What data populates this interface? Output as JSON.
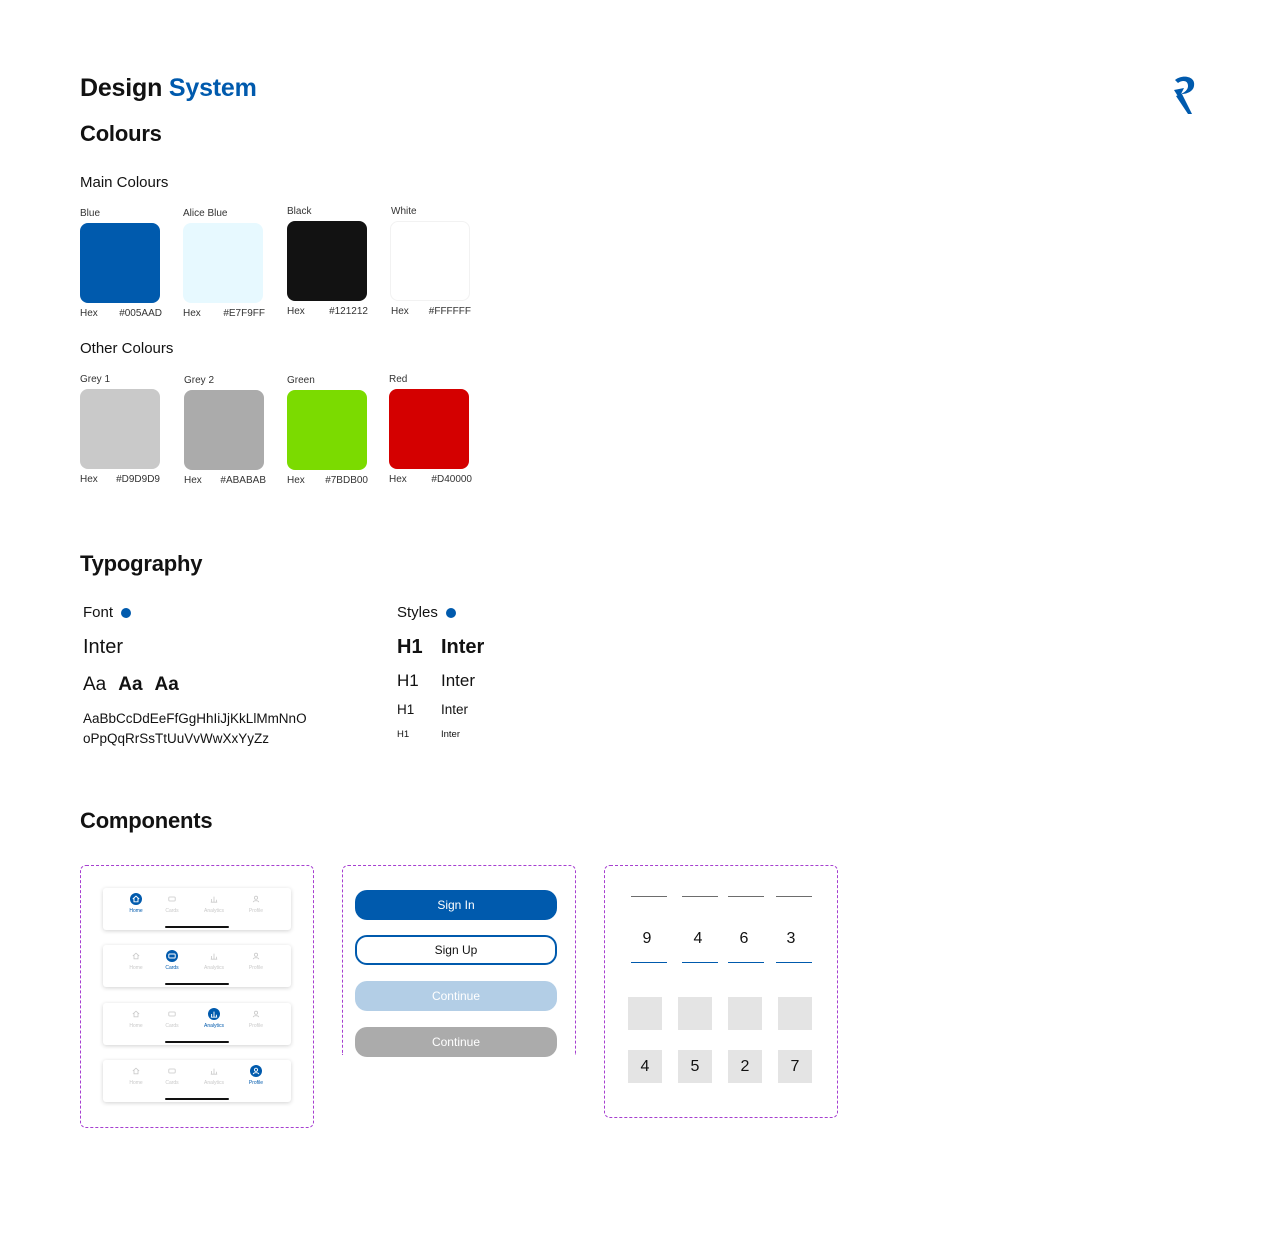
{
  "title": {
    "part1": "Design",
    "part2": "System"
  },
  "colours": {
    "heading": "Colours",
    "main": {
      "heading": "Main Colours",
      "swatches": [
        {
          "name": "Blue",
          "hex_label": "Hex",
          "hex": "#005AAD"
        },
        {
          "name": "Alice Blue",
          "hex_label": "Hex",
          "hex": "#E7F9FF"
        },
        {
          "name": "Black",
          "hex_label": "Hex",
          "hex": "#121212"
        },
        {
          "name": "White",
          "hex_label": "Hex",
          "hex": "#FFFFFF"
        }
      ]
    },
    "other": {
      "heading": "Other Colours",
      "swatches": [
        {
          "name": "Grey 1",
          "hex_label": "Hex",
          "hex": "#D9D9D9"
        },
        {
          "name": "Grey 2",
          "hex_label": "Hex",
          "hex": "#ABABAB"
        },
        {
          "name": "Green",
          "hex_label": "Hex",
          "hex": "#7BDB00"
        },
        {
          "name": "Red",
          "hex_label": "Hex",
          "hex": "#D40000"
        }
      ]
    }
  },
  "typography": {
    "heading": "Typography",
    "font": {
      "label": "Font",
      "name": "Inter",
      "samples": [
        "Aa",
        "Aa",
        "Aa"
      ],
      "alphabet_line1": "AaBbCcDdEeFfGgHhIiJjKkLlMmNnO",
      "alphabet_line2": "oPpQqRrSsTtUuVvWwXxYyZz"
    },
    "styles": {
      "label": "Styles",
      "rows": [
        {
          "tag": "H1",
          "font": "Inter"
        },
        {
          "tag": "H1",
          "font": "Inter"
        },
        {
          "tag": "H1",
          "font": "Inter"
        },
        {
          "tag": "H1",
          "font": "Inter"
        }
      ]
    }
  },
  "components": {
    "heading": "Components",
    "nav_labels": [
      "Home",
      "Cards",
      "Analytics",
      "Profile"
    ],
    "nav_icons": [
      "home-icon",
      "cards-icon",
      "analytics-icon",
      "profile-icon"
    ],
    "buttons": {
      "sign_in": "Sign In",
      "sign_up": "Sign Up",
      "continue_light": "Continue",
      "continue_grey": "Continue"
    },
    "otp_digits": [
      "9",
      "4",
      "6",
      "3"
    ],
    "pin_digits": [
      "4",
      "5",
      "2",
      "7"
    ]
  },
  "colors": {
    "accent": "#005AAD",
    "border": "#A63FD0"
  }
}
